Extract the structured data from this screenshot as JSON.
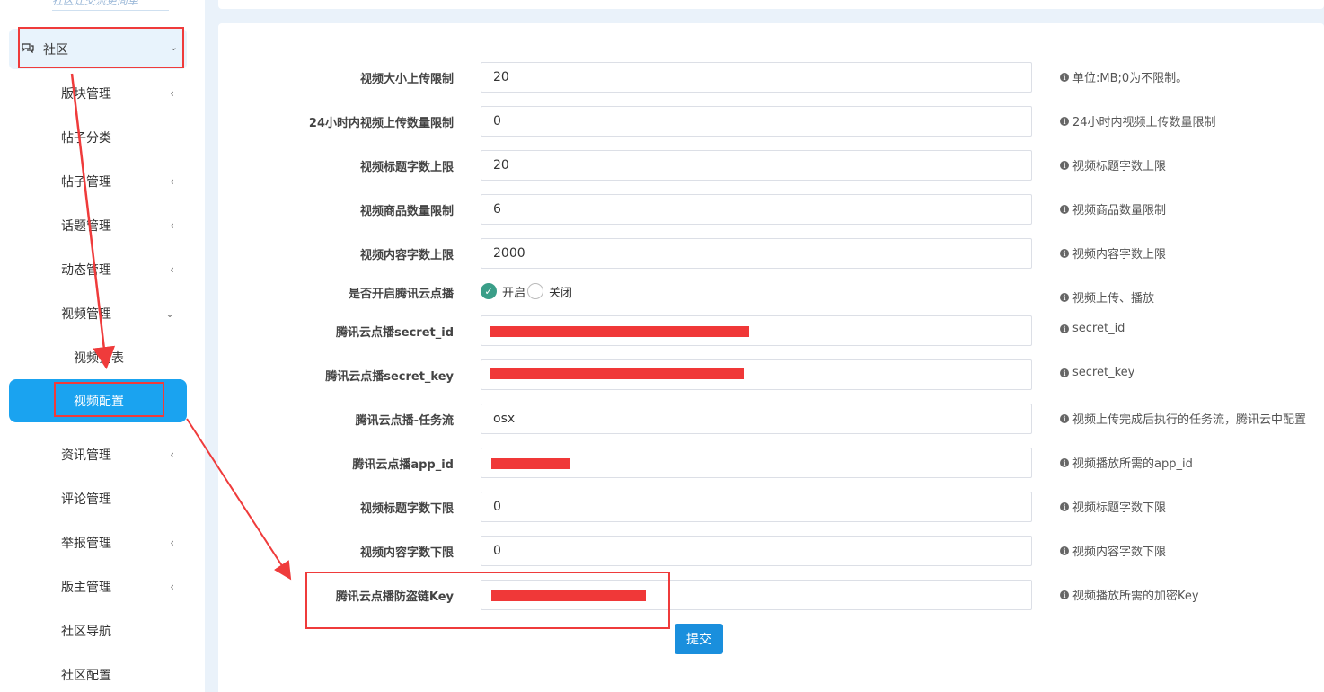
{
  "sidebar": {
    "logo_text": "社区让交流更简单",
    "root": {
      "label": "社区",
      "icon": "chat-bubbles-icon"
    },
    "items": [
      {
        "label": "版块管理",
        "has_children": true
      },
      {
        "label": "帖子分类",
        "has_children": false
      },
      {
        "label": "帖子管理",
        "has_children": true
      },
      {
        "label": "话题管理",
        "has_children": true
      },
      {
        "label": "动态管理",
        "has_children": true
      },
      {
        "label": "视频管理",
        "has_children": true,
        "expanded": true
      },
      {
        "label": "视频列表",
        "sub": true
      },
      {
        "label": "视频配置",
        "sub": true,
        "active": true
      },
      {
        "label": "资讯管理",
        "has_children": true
      },
      {
        "label": "评论管理",
        "has_children": false
      },
      {
        "label": "举报管理",
        "has_children": true
      },
      {
        "label": "版主管理",
        "has_children": true
      },
      {
        "label": "社区导航",
        "has_children": false
      },
      {
        "label": "社区配置",
        "has_children": false
      }
    ]
  },
  "form": {
    "rows": [
      {
        "label": "视频大小上传限制",
        "value": "20",
        "hint": "单位:MB;0为不限制。"
      },
      {
        "label": "24小时内视频上传数量限制",
        "value": "0",
        "hint": "24小时内视频上传数量限制"
      },
      {
        "label": "视频标题字数上限",
        "value": "20",
        "hint": "视频标题字数上限"
      },
      {
        "label": "视频商品数量限制",
        "value": "6",
        "hint": "视频商品数量限制"
      },
      {
        "label": "视频内容字数上限",
        "value": "2000",
        "hint": "视频内容字数上限"
      },
      {
        "label": "是否开启腾讯云点播",
        "radio": true,
        "options": [
          "开启",
          "关闭"
        ],
        "selected": "开启",
        "hint": "视频上传、播放"
      },
      {
        "label": "腾讯云点播secret_id",
        "value": "",
        "redacted": true,
        "hint": "secret_id"
      },
      {
        "label": "腾讯云点播secret_key",
        "value": "",
        "redacted": true,
        "hint": "secret_key"
      },
      {
        "label": "腾讯云点播-任务流",
        "value": "osx",
        "hint": "视频上传完成后执行的任务流，腾讯云中配置"
      },
      {
        "label": "腾讯云点播app_id",
        "value": "",
        "redacted": true,
        "hint": "视频播放所需的app_id"
      },
      {
        "label": "视频标题字数下限",
        "value": "0",
        "hint": "视频标题字数下限"
      },
      {
        "label": "视频内容字数下限",
        "value": "0",
        "hint": "视频内容字数下限"
      },
      {
        "label": "腾讯云点播防盗链Key",
        "value": "",
        "redacted": true,
        "hint": "视频播放所需的加密Key"
      }
    ],
    "submit_label": "提交"
  },
  "colors": {
    "accent": "#1aa3f0",
    "annotation": "#ef3b3b",
    "radio_checked": "#3a9e88"
  }
}
